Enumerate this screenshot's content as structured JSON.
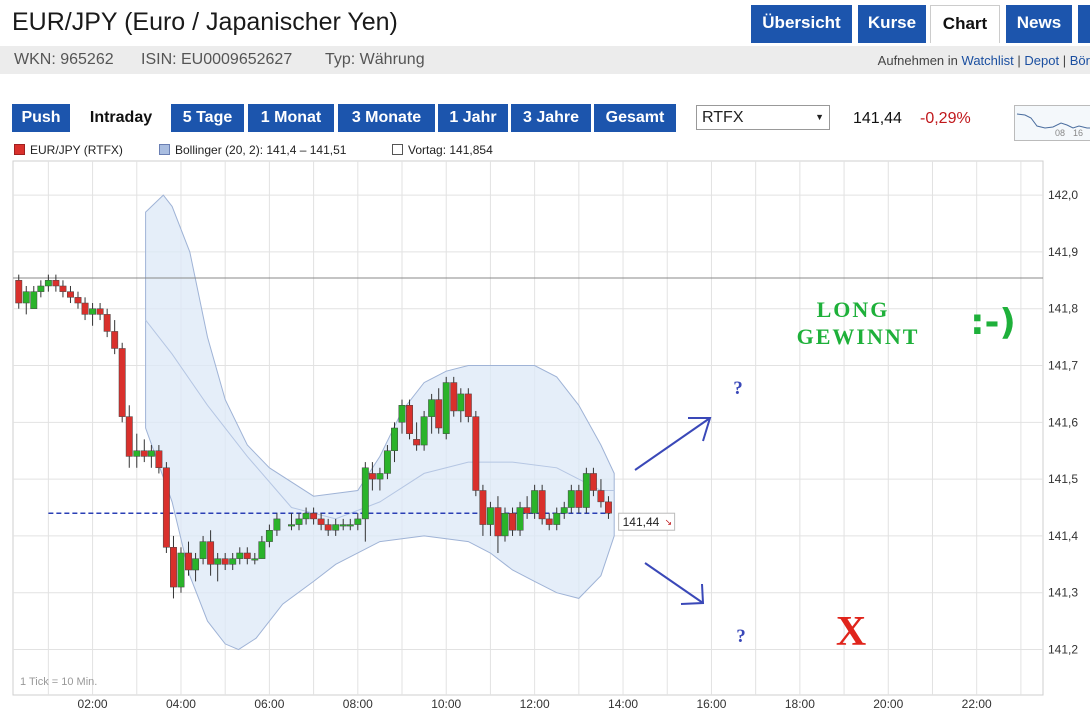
{
  "header": {
    "title": "EUR/JPY (Euro / Japanischer Yen)",
    "wkn": "WKN: 965262",
    "isin": "ISIN: EU0009652627",
    "typ": "Typ: Währung",
    "add_label": "Aufnehmen in",
    "links": [
      "Watchlist",
      "Depot",
      "Bör"
    ],
    "nav": [
      "Übersicht",
      "Kurse",
      "Chart",
      "News"
    ],
    "active_nav": "Chart"
  },
  "toolbar": {
    "ranges": [
      "Push",
      "Intraday",
      "5 Tage",
      "1 Monat",
      "3 Monate",
      "1 Jahr",
      "3 Jahre",
      "Gesamt"
    ],
    "active_range": "Intraday",
    "exchange": "RTFX",
    "price": "141,44",
    "change": "-0,29%",
    "thumb_labels": [
      "08",
      "16"
    ]
  },
  "legend": {
    "series": "EUR/JPY (RTFX)",
    "bollinger": "Bollinger (20, 2): 141,4 – 141,51",
    "vortag": "Vortag: 141,854"
  },
  "annotations": {
    "long_line1": "LONG",
    "long_line2": "GEWINNT",
    "smiley": ":-)",
    "question_up": "?",
    "question_down": "?",
    "cross": "X",
    "tick_note": "1 Tick = 10 Min."
  },
  "colors": {
    "accent": "#1c55ad",
    "up": "#2ab32a",
    "down": "#d9302c",
    "band": "#dce8f7",
    "annotation_green": "#1eb03a",
    "annotation_blue": "#3a48b8",
    "cross_red": "#e0241b"
  },
  "chart_data": {
    "type": "candlestick",
    "title": "",
    "xlabel": "",
    "ylabel": "",
    "x_ticks": [
      "02:00",
      "04:00",
      "06:00",
      "08:00",
      "10:00",
      "12:00",
      "14:00",
      "16:00",
      "18:00",
      "20:00",
      "22:00"
    ],
    "y_ticks": [
      "142,0",
      "141,9",
      "141,8",
      "141,7",
      "141,6",
      "141,5",
      "141,4",
      "141,3",
      "141,2"
    ],
    "ylim": [
      141.12,
      142.06
    ],
    "x_range_hours": [
      0.2,
      23.5
    ],
    "previous_close": 141.854,
    "last_price": 141.44,
    "last_price_label": "141,44",
    "grid": true,
    "candles": [
      {
        "t": 0.33,
        "o": 141.85,
        "h": 141.86,
        "l": 141.8,
        "c": 141.81
      },
      {
        "t": 0.5,
        "o": 141.81,
        "h": 141.84,
        "l": 141.79,
        "c": 141.83
      },
      {
        "t": 0.67,
        "o": 141.8,
        "h": 141.84,
        "l": 141.8,
        "c": 141.83
      },
      {
        "t": 0.83,
        "o": 141.83,
        "h": 141.85,
        "l": 141.82,
        "c": 141.84
      },
      {
        "t": 1.0,
        "o": 141.84,
        "h": 141.86,
        "l": 141.83,
        "c": 141.85
      },
      {
        "t": 1.17,
        "o": 141.85,
        "h": 141.86,
        "l": 141.83,
        "c": 141.84
      },
      {
        "t": 1.33,
        "o": 141.84,
        "h": 141.85,
        "l": 141.82,
        "c": 141.83
      },
      {
        "t": 1.5,
        "o": 141.83,
        "h": 141.84,
        "l": 141.81,
        "c": 141.82
      },
      {
        "t": 1.67,
        "o": 141.82,
        "h": 141.83,
        "l": 141.8,
        "c": 141.81
      },
      {
        "t": 1.83,
        "o": 141.81,
        "h": 141.82,
        "l": 141.78,
        "c": 141.79
      },
      {
        "t": 2.0,
        "o": 141.79,
        "h": 141.81,
        "l": 141.77,
        "c": 141.8
      },
      {
        "t": 2.17,
        "o": 141.8,
        "h": 141.81,
        "l": 141.78,
        "c": 141.79
      },
      {
        "t": 2.33,
        "o": 141.79,
        "h": 141.8,
        "l": 141.75,
        "c": 141.76
      },
      {
        "t": 2.5,
        "o": 141.76,
        "h": 141.78,
        "l": 141.72,
        "c": 141.73
      },
      {
        "t": 2.67,
        "o": 141.73,
        "h": 141.74,
        "l": 141.6,
        "c": 141.61
      },
      {
        "t": 2.83,
        "o": 141.61,
        "h": 141.63,
        "l": 141.52,
        "c": 141.54
      },
      {
        "t": 3.0,
        "o": 141.54,
        "h": 141.58,
        "l": 141.52,
        "c": 141.55
      },
      {
        "t": 3.17,
        "o": 141.55,
        "h": 141.57,
        "l": 141.53,
        "c": 141.54
      },
      {
        "t": 3.33,
        "o": 141.54,
        "h": 141.56,
        "l": 141.52,
        "c": 141.55
      },
      {
        "t": 3.5,
        "o": 141.55,
        "h": 141.56,
        "l": 141.51,
        "c": 141.52
      },
      {
        "t": 3.67,
        "o": 141.52,
        "h": 141.53,
        "l": 141.37,
        "c": 141.38
      },
      {
        "t": 3.83,
        "o": 141.38,
        "h": 141.4,
        "l": 141.29,
        "c": 141.31
      },
      {
        "t": 4.0,
        "o": 141.31,
        "h": 141.38,
        "l": 141.3,
        "c": 141.37
      },
      {
        "t": 4.17,
        "o": 141.37,
        "h": 141.39,
        "l": 141.33,
        "c": 141.34
      },
      {
        "t": 4.33,
        "o": 141.34,
        "h": 141.37,
        "l": 141.32,
        "c": 141.36
      },
      {
        "t": 4.5,
        "o": 141.36,
        "h": 141.4,
        "l": 141.35,
        "c": 141.39
      },
      {
        "t": 4.67,
        "o": 141.39,
        "h": 141.41,
        "l": 141.33,
        "c": 141.35
      },
      {
        "t": 4.83,
        "o": 141.35,
        "h": 141.37,
        "l": 141.32,
        "c": 141.36
      },
      {
        "t": 5.0,
        "o": 141.36,
        "h": 141.37,
        "l": 141.34,
        "c": 141.35
      },
      {
        "t": 5.17,
        "o": 141.35,
        "h": 141.37,
        "l": 141.34,
        "c": 141.36
      },
      {
        "t": 5.33,
        "o": 141.36,
        "h": 141.38,
        "l": 141.35,
        "c": 141.37
      },
      {
        "t": 5.5,
        "o": 141.37,
        "h": 141.38,
        "l": 141.35,
        "c": 141.36
      },
      {
        "t": 5.67,
        "o": 141.36,
        "h": 141.37,
        "l": 141.35,
        "c": 141.36
      },
      {
        "t": 5.83,
        "o": 141.36,
        "h": 141.4,
        "l": 141.36,
        "c": 141.39
      },
      {
        "t": 6.0,
        "o": 141.39,
        "h": 141.42,
        "l": 141.38,
        "c": 141.41
      },
      {
        "t": 6.17,
        "o": 141.41,
        "h": 141.44,
        "l": 141.4,
        "c": 141.43
      },
      {
        "t": 6.5,
        "o": 141.42,
        "h": 141.44,
        "l": 141.41,
        "c": 141.42
      },
      {
        "t": 6.67,
        "o": 141.42,
        "h": 141.44,
        "l": 141.41,
        "c": 141.43
      },
      {
        "t": 6.83,
        "o": 141.43,
        "h": 141.45,
        "l": 141.42,
        "c": 141.44
      },
      {
        "t": 7.0,
        "o": 141.44,
        "h": 141.45,
        "l": 141.42,
        "c": 141.43
      },
      {
        "t": 7.17,
        "o": 141.43,
        "h": 141.44,
        "l": 141.41,
        "c": 141.42
      },
      {
        "t": 7.33,
        "o": 141.42,
        "h": 141.43,
        "l": 141.4,
        "c": 141.41
      },
      {
        "t": 7.5,
        "o": 141.41,
        "h": 141.43,
        "l": 141.4,
        "c": 141.42
      },
      {
        "t": 7.67,
        "o": 141.42,
        "h": 141.43,
        "l": 141.41,
        "c": 141.42
      },
      {
        "t": 7.83,
        "o": 141.42,
        "h": 141.43,
        "l": 141.41,
        "c": 141.42
      },
      {
        "t": 8.0,
        "o": 141.42,
        "h": 141.44,
        "l": 141.41,
        "c": 141.43
      },
      {
        "t": 8.17,
        "o": 141.43,
        "h": 141.53,
        "l": 141.39,
        "c": 141.52
      },
      {
        "t": 8.33,
        "o": 141.51,
        "h": 141.53,
        "l": 141.48,
        "c": 141.5
      },
      {
        "t": 8.5,
        "o": 141.5,
        "h": 141.52,
        "l": 141.48,
        "c": 141.51
      },
      {
        "t": 8.67,
        "o": 141.51,
        "h": 141.56,
        "l": 141.5,
        "c": 141.55
      },
      {
        "t": 8.83,
        "o": 141.55,
        "h": 141.6,
        "l": 141.53,
        "c": 141.59
      },
      {
        "t": 9.0,
        "o": 141.6,
        "h": 141.64,
        "l": 141.58,
        "c": 141.63
      },
      {
        "t": 9.17,
        "o": 141.63,
        "h": 141.64,
        "l": 141.57,
        "c": 141.58
      },
      {
        "t": 9.33,
        "o": 141.57,
        "h": 141.6,
        "l": 141.55,
        "c": 141.56
      },
      {
        "t": 9.5,
        "o": 141.56,
        "h": 141.62,
        "l": 141.55,
        "c": 141.61
      },
      {
        "t": 9.67,
        "o": 141.61,
        "h": 141.65,
        "l": 141.58,
        "c": 141.64
      },
      {
        "t": 9.83,
        "o": 141.64,
        "h": 141.66,
        "l": 141.58,
        "c": 141.59
      },
      {
        "t": 10.0,
        "o": 141.58,
        "h": 141.68,
        "l": 141.57,
        "c": 141.67
      },
      {
        "t": 10.17,
        "o": 141.67,
        "h": 141.68,
        "l": 141.61,
        "c": 141.62
      },
      {
        "t": 10.33,
        "o": 141.62,
        "h": 141.66,
        "l": 141.6,
        "c": 141.65
      },
      {
        "t": 10.5,
        "o": 141.65,
        "h": 141.66,
        "l": 141.6,
        "c": 141.61
      },
      {
        "t": 10.67,
        "o": 141.61,
        "h": 141.62,
        "l": 141.47,
        "c": 141.48
      },
      {
        "t": 10.83,
        "o": 141.48,
        "h": 141.49,
        "l": 141.4,
        "c": 141.42
      },
      {
        "t": 11.0,
        "o": 141.42,
        "h": 141.46,
        "l": 141.4,
        "c": 141.45
      },
      {
        "t": 11.17,
        "o": 141.45,
        "h": 141.47,
        "l": 141.37,
        "c": 141.4
      },
      {
        "t": 11.33,
        "o": 141.4,
        "h": 141.45,
        "l": 141.39,
        "c": 141.44
      },
      {
        "t": 11.5,
        "o": 141.44,
        "h": 141.45,
        "l": 141.4,
        "c": 141.41
      },
      {
        "t": 11.67,
        "o": 141.41,
        "h": 141.46,
        "l": 141.4,
        "c": 141.45
      },
      {
        "t": 11.83,
        "o": 141.45,
        "h": 141.47,
        "l": 141.43,
        "c": 141.44
      },
      {
        "t": 12.0,
        "o": 141.44,
        "h": 141.49,
        "l": 141.43,
        "c": 141.48
      },
      {
        "t": 12.17,
        "o": 141.48,
        "h": 141.49,
        "l": 141.42,
        "c": 141.43
      },
      {
        "t": 12.33,
        "o": 141.43,
        "h": 141.44,
        "l": 141.41,
        "c": 141.42
      },
      {
        "t": 12.5,
        "o": 141.42,
        "h": 141.45,
        "l": 141.41,
        "c": 141.44
      },
      {
        "t": 12.67,
        "o": 141.44,
        "h": 141.46,
        "l": 141.43,
        "c": 141.45
      },
      {
        "t": 12.83,
        "o": 141.45,
        "h": 141.49,
        "l": 141.44,
        "c": 141.48
      },
      {
        "t": 13.0,
        "o": 141.48,
        "h": 141.49,
        "l": 141.44,
        "c": 141.45
      },
      {
        "t": 13.17,
        "o": 141.45,
        "h": 141.52,
        "l": 141.44,
        "c": 141.51
      },
      {
        "t": 13.33,
        "o": 141.51,
        "h": 141.52,
        "l": 141.47,
        "c": 141.48
      },
      {
        "t": 13.5,
        "o": 141.48,
        "h": 141.5,
        "l": 141.45,
        "c": 141.46
      },
      {
        "t": 13.67,
        "o": 141.46,
        "h": 141.47,
        "l": 141.43,
        "c": 141.44
      }
    ],
    "bollinger": {
      "upper": [
        [
          3.2,
          141.97
        ],
        [
          3.6,
          142.0
        ],
        [
          3.8,
          141.98
        ],
        [
          4.2,
          141.9
        ],
        [
          4.6,
          141.75
        ],
        [
          5.0,
          141.64
        ],
        [
          5.5,
          141.56
        ],
        [
          6.0,
          141.52
        ],
        [
          7.0,
          141.47
        ],
        [
          8.0,
          141.48
        ],
        [
          8.5,
          141.54
        ],
        [
          9.0,
          141.62
        ],
        [
          9.5,
          141.67
        ],
        [
          10.0,
          141.69
        ],
        [
          10.5,
          141.7
        ],
        [
          11.0,
          141.7
        ],
        [
          11.5,
          141.7
        ],
        [
          12.0,
          141.7
        ],
        [
          12.5,
          141.68
        ],
        [
          13.0,
          141.63
        ],
        [
          13.5,
          141.56
        ],
        [
          13.8,
          141.51
        ]
      ],
      "middle": [
        [
          3.2,
          141.78
        ],
        [
          3.8,
          141.72
        ],
        [
          4.6,
          141.63
        ],
        [
          5.5,
          141.54
        ],
        [
          6.5,
          141.45
        ],
        [
          7.5,
          141.43
        ],
        [
          8.5,
          141.46
        ],
        [
          9.5,
          141.51
        ],
        [
          10.5,
          141.53
        ],
        [
          11.5,
          141.53
        ],
        [
          12.5,
          141.52
        ],
        [
          13.5,
          141.48
        ],
        [
          13.8,
          141.48
        ]
      ],
      "lower": [
        [
          3.2,
          141.59
        ],
        [
          3.8,
          141.46
        ],
        [
          4.2,
          141.33
        ],
        [
          4.6,
          141.25
        ],
        [
          5.0,
          141.21
        ],
        [
          5.3,
          141.2
        ],
        [
          5.7,
          141.22
        ],
        [
          6.3,
          141.28
        ],
        [
          7.0,
          141.32
        ],
        [
          7.5,
          141.35
        ],
        [
          8.5,
          141.39
        ],
        [
          9.5,
          141.4
        ],
        [
          10.5,
          141.39
        ],
        [
          11.0,
          141.37
        ],
        [
          11.5,
          141.34
        ],
        [
          12.0,
          141.32
        ],
        [
          12.5,
          141.3
        ],
        [
          13.0,
          141.29
        ],
        [
          13.5,
          141.33
        ],
        [
          13.8,
          141.4
        ]
      ]
    }
  }
}
